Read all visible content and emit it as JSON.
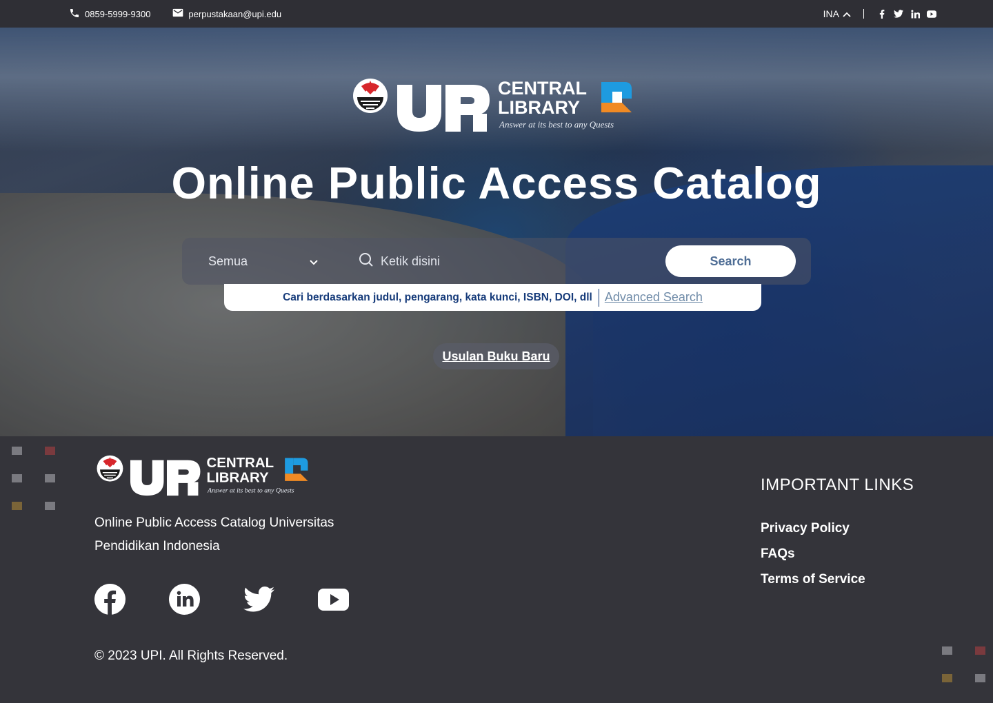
{
  "topbar": {
    "phone": "0859-5999-9300",
    "email": "perpustakaan@upi.edu",
    "language": "INA",
    "social_icons": [
      "facebook-icon",
      "twitter-icon",
      "linkedin-icon",
      "youtube-icon"
    ]
  },
  "logo": {
    "word_main": "UPI",
    "line1": "CENTRAL",
    "line2": "LIBRARY",
    "tagline": "Answer at its best to any Quests"
  },
  "hero": {
    "title": "Online Public Access Catalog",
    "select_value": "Semua",
    "search_placeholder": "Ketik disini",
    "search_button": "Search",
    "hint_text": "Cari berdasarkan judul, pengarang, kata kunci, ISBN, DOI, dll",
    "advanced_search": "Advanced Search",
    "new_book_suggestion": "Usulan Buku Baru"
  },
  "footer": {
    "description": "Online Public Access Catalog Universitas Pendidikan Indonesia",
    "social_icons": [
      "facebook-icon",
      "linkedin-icon",
      "twitter-icon",
      "youtube-icon"
    ],
    "copyright": "© 2023 UPI. All Rights Reserved.",
    "links_title": "IMPORTANT LINKS",
    "links": [
      "Privacy Policy",
      "FAQs",
      "Terms of Service"
    ]
  },
  "colors": {
    "topbar_bg": "#2f2f35",
    "footer_bg": "#34343a",
    "search_text": "#4e6d95",
    "hint_text": "#163b7a",
    "advanced_link": "#6f8ba8",
    "logo_orange": "#f08a24",
    "logo_blue": "#1e9be0",
    "square_gray": "#7a7a80",
    "square_red": "#7a3a3e",
    "square_gold": "#7a6438"
  }
}
